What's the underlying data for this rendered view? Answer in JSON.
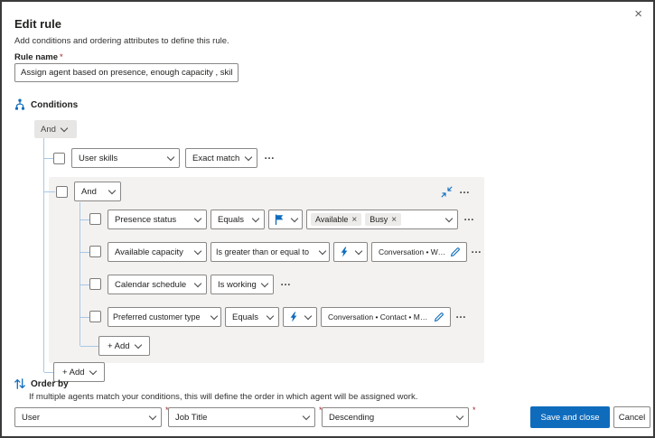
{
  "colors": {
    "primary": "#0f6cbd",
    "group_background": "#f3f2f1",
    "control_border": "#8a8886",
    "tree_line": "#a9c7e5",
    "required": "#a4262c"
  },
  "icons": {
    "close": "×",
    "more": "…",
    "tag_remove": "×"
  },
  "dialog": {
    "title": "Edit rule",
    "subtitle": "Add conditions and ordering attributes to define this rule."
  },
  "rule_name": {
    "label": "Rule name",
    "required_marker": "*",
    "value": "Assign agent based on presence, enough capacity , skills  , agent preferr..."
  },
  "conditions": {
    "section_label": "Conditions",
    "root_operator": "And",
    "top_row": {
      "field": "User skills",
      "operator": "Exact match"
    },
    "group": {
      "operator": "And",
      "rows": [
        {
          "field": "Presence status",
          "operator": "Equals",
          "tags": [
            {
              "label": "Available"
            },
            {
              "label": "Busy"
            }
          ]
        },
        {
          "field": "Available capacity",
          "operator": "Is greater than or equal to",
          "value": "Conversation • Work Stream • Ca..."
        },
        {
          "field": "Calendar schedule",
          "operator": "Is working"
        },
        {
          "field": "Preferred customer type",
          "operator": "Equals",
          "value": "Conversation • Contact • Membe..."
        }
      ],
      "add_label": "+ Add"
    },
    "add_label": "+ Add"
  },
  "order_by": {
    "section_label": "Order by",
    "description": "If multiple agents match your conditions, this will define the order in which agent will be assigned work.",
    "fields": [
      {
        "value": "User",
        "required_marker": "*"
      },
      {
        "value": "Job Title",
        "required_marker": "*"
      },
      {
        "value": "Descending",
        "required_marker": "*"
      }
    ]
  },
  "footer": {
    "save_label": "Save and close",
    "cancel_label": "Cancel"
  }
}
